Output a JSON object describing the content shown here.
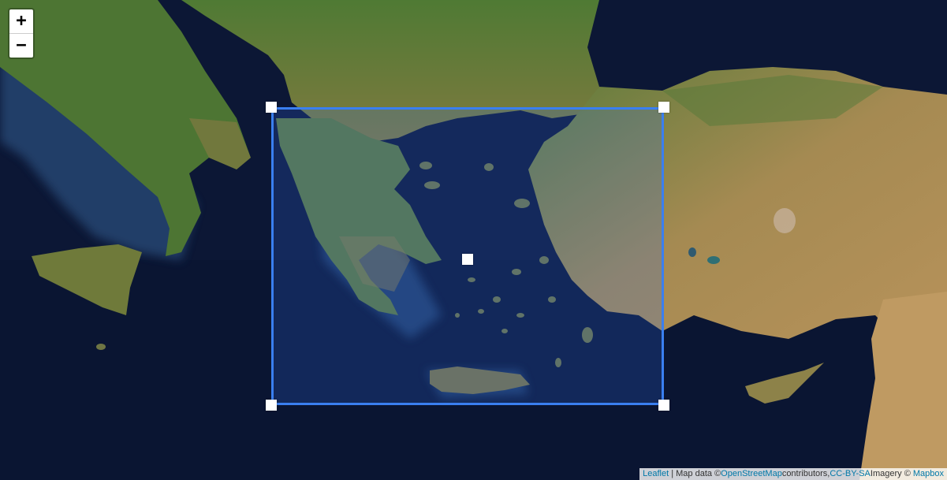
{
  "map": {
    "style": "satellite",
    "colors": {
      "sea": "#0e1a3a",
      "deep_sea": "#0a1430",
      "shallow_glow": "#2a4d7a",
      "land_green": "#3f6b2a",
      "land_tan": "#a8894f",
      "selection": "#3a7ff0"
    }
  },
  "zoom_control": {
    "zoom_in_label": "+",
    "zoom_out_label": "−"
  },
  "selection": {
    "handles": [
      "top-left",
      "top-right",
      "bottom-left",
      "bottom-right",
      "center"
    ]
  },
  "attribution": {
    "leaflet": "Leaflet",
    "sep": " | ",
    "map_data_text": "Map data ©",
    "osm": "OpenStreetMap",
    "contributors": "contributors,",
    "license": "CC-BY-SA",
    "imagery_text": "Imagery © ",
    "provider": "Mapbox"
  }
}
